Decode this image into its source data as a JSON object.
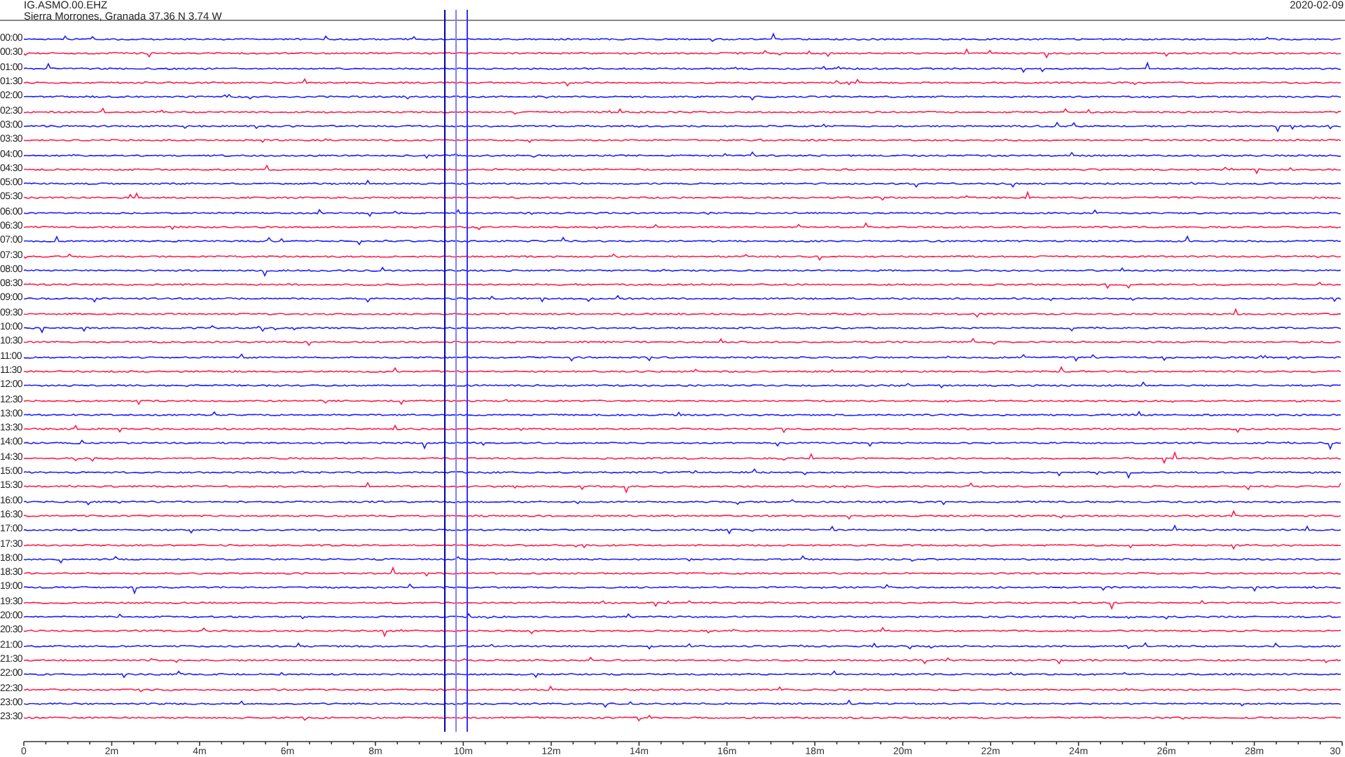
{
  "header": {
    "station": "IG.ASMO.00.EHZ",
    "location": "Sierra Morrones, Granada  37.36 N 3.74 W",
    "date": "2020-02-09"
  },
  "rows": [
    {
      "label": "00:00",
      "color": "#2020ff"
    },
    {
      "label": "00:30",
      "color": "#ff1f4b"
    },
    {
      "label": "01:00",
      "color": "#2020ff"
    },
    {
      "label": "01:30",
      "color": "#ff1f4b"
    },
    {
      "label": "02:00",
      "color": "#2020ff"
    },
    {
      "label": "02:30",
      "color": "#ff1f4b"
    },
    {
      "label": "03:00",
      "color": "#2020ff"
    },
    {
      "label": "03:30",
      "color": "#ff1f4b"
    },
    {
      "label": "04:00",
      "color": "#2020ff"
    },
    {
      "label": "04:30",
      "color": "#ff1f4b"
    },
    {
      "label": "05:00",
      "color": "#2020ff"
    },
    {
      "label": "05:30",
      "color": "#ff1f4b"
    },
    {
      "label": "06:00",
      "color": "#2020ff"
    },
    {
      "label": "06:30",
      "color": "#ff1f4b"
    },
    {
      "label": "07:00",
      "color": "#2020ff"
    },
    {
      "label": "07:30",
      "color": "#ff1f4b"
    },
    {
      "label": "08:00",
      "color": "#2020ff"
    },
    {
      "label": "08:30",
      "color": "#ff1f4b"
    },
    {
      "label": "09:00",
      "color": "#2020ff"
    },
    {
      "label": "09:30",
      "color": "#ff1f4b"
    },
    {
      "label": "10:00",
      "color": "#2020ff"
    },
    {
      "label": "10:30",
      "color": "#ff1f4b"
    },
    {
      "label": "11:00",
      "color": "#2020ff"
    },
    {
      "label": "11:30",
      "color": "#ff1f4b"
    },
    {
      "label": "12:00",
      "color": "#2020ff"
    },
    {
      "label": "12:30",
      "color": "#ff1f4b"
    },
    {
      "label": "13:00",
      "color": "#2020ff"
    },
    {
      "label": "13:30",
      "color": "#ff1f4b"
    },
    {
      "label": "14:00",
      "color": "#2020ff"
    },
    {
      "label": "14:30",
      "color": "#ff1f4b"
    },
    {
      "label": "15:00",
      "color": "#2020ff"
    },
    {
      "label": "15:30",
      "color": "#ff1f4b"
    },
    {
      "label": "16:00",
      "color": "#2020ff"
    },
    {
      "label": "16:30",
      "color": "#ff1f4b"
    },
    {
      "label": "17:00",
      "color": "#2020ff"
    },
    {
      "label": "17:30",
      "color": "#ff1f4b"
    },
    {
      "label": "18:00",
      "color": "#2020ff"
    },
    {
      "label": "18:30",
      "color": "#ff1f4b"
    },
    {
      "label": "19:00",
      "color": "#2020ff"
    },
    {
      "label": "19:30",
      "color": "#ff1f4b"
    },
    {
      "label": "20:00",
      "color": "#2020ff"
    },
    {
      "label": "20:30",
      "color": "#ff1f4b"
    },
    {
      "label": "21:00",
      "color": "#2020ff"
    },
    {
      "label": "21:30",
      "color": "#ff1f4b"
    },
    {
      "label": "22:00",
      "color": "#2020ff"
    },
    {
      "label": "22:30",
      "color": "#ff1f4b"
    },
    {
      "label": "23:00",
      "color": "#2020ff"
    },
    {
      "label": "23:30",
      "color": "#ff1f4b"
    }
  ],
  "x_axis": [
    "0",
    "2m",
    "4m",
    "6m",
    "8m",
    "10m",
    "12m",
    "14m",
    "16m",
    "18m",
    "20m",
    "22m",
    "24m",
    "26m",
    "28m",
    "30"
  ]
}
